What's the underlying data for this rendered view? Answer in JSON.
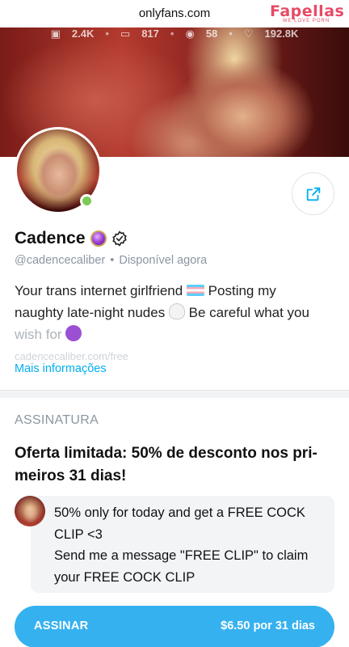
{
  "browser": {
    "url": "onlyfans.com"
  },
  "watermark": {
    "title": "Fapellas",
    "subtitle": "WE LOVE PORN"
  },
  "cover_stats": {
    "photos": "2.4K",
    "videos": "817",
    "streams": "58",
    "likes": "192.8K"
  },
  "profile": {
    "name": "Cadence",
    "handle": "@cadencecaliber",
    "status": "Disponível agora",
    "bio_line1": "Your trans internet girlfriend",
    "bio_line1b": " Posting my",
    "bio_line2": "naughty late-night nudes",
    "bio_line2b": " Be careful what you",
    "bio_line3": "wish for",
    "bio_faded": "cadencecaliber.com/free",
    "more_info": "Mais informações"
  },
  "subscription": {
    "section_label": "ASSINATURA",
    "offer_title": "Oferta limitada: 50% de desconto nos pri-meiros 31 dias!",
    "message_line1": "50% only for today and get a FREE COCK CLIP <3",
    "message_line2": "Send me a message \"FREE CLIP\" to claim your FREE COCK CLIP",
    "button_label": "ASSINAR",
    "button_price": "$6.50 por 31 dias"
  },
  "colors": {
    "accent": "#00aff0",
    "button": "#36b1f0",
    "online": "#7acb55",
    "muted": "#8a96a3"
  }
}
